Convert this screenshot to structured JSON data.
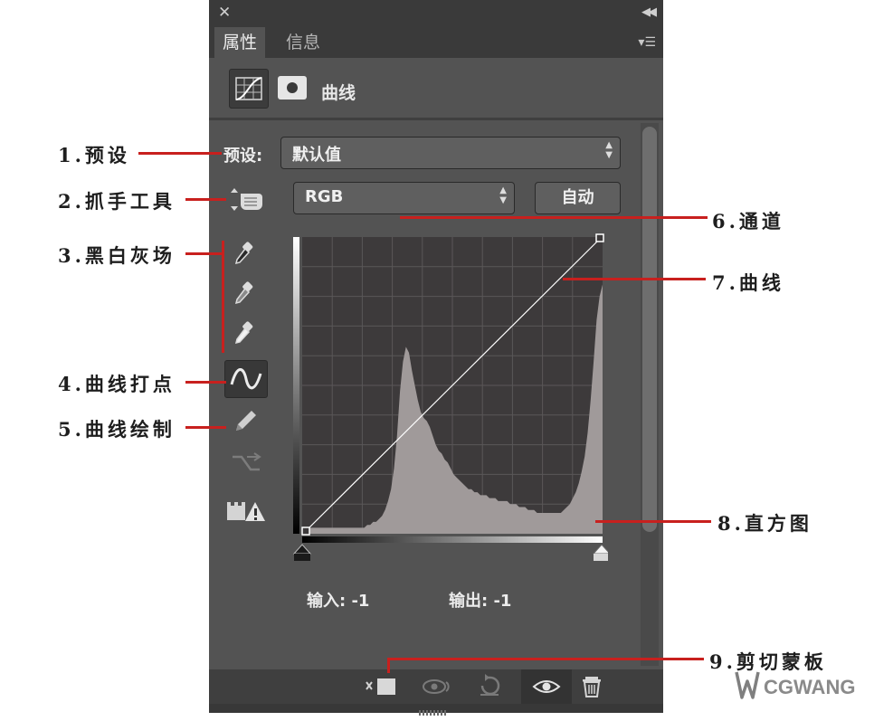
{
  "panel": {
    "tabs": [
      "属性",
      "信息"
    ],
    "active_tab": 0,
    "adjustment_title": "曲线",
    "preset_label": "预设:",
    "preset_value": "默认值",
    "channel_value": "RGB",
    "auto_button": "自动",
    "input_readout": "输入: -1",
    "output_readout": "输出: -1"
  },
  "annotations": [
    {
      "id": "1",
      "text": "1.预设"
    },
    {
      "id": "2",
      "text": "2.抓手工具"
    },
    {
      "id": "3",
      "text": "3.黑白灰场"
    },
    {
      "id": "4",
      "text": "4.曲线打点"
    },
    {
      "id": "5",
      "text": "5.曲线绘制"
    },
    {
      "id": "6",
      "text": "6.通道"
    },
    {
      "id": "7",
      "text": "7.曲线"
    },
    {
      "id": "8",
      "text": "8.直方图"
    },
    {
      "id": "9",
      "text": "9.剪切蒙板"
    }
  ],
  "icons": {
    "close": "close-icon",
    "collapse": "collapse-icon",
    "panel_menu": "panel-menu-icon",
    "curves_adjustment": "curves-adjustment-icon",
    "mask": "mask-icon",
    "hand_tool": "targeted-adjustment-hand-icon",
    "eyedroppers": [
      "black-point-eyedropper-icon",
      "gray-point-eyedropper-icon",
      "white-point-eyedropper-icon"
    ],
    "point_mode": "curve-point-edit-icon",
    "pencil_mode": "curve-pencil-icon",
    "smooth": "smooth-curve-icon",
    "clipping_warning": "clipping-warning-icon",
    "bottom": [
      "clip-to-layer-icon",
      "view-previous-state-icon",
      "reset-icon",
      "visibility-eye-icon",
      "delete-icon"
    ]
  },
  "watermark": "CGWANG",
  "colors": {
    "panel_bg": "#535353",
    "annotation_line": "#c8201e",
    "histogram_fill": "#a09a9a"
  },
  "histogram": [
    0.02,
    0.02,
    0.02,
    0.02,
    0.02,
    0.02,
    0.02,
    0.02,
    0.02,
    0.02,
    0.02,
    0.02,
    0.02,
    0.02,
    0.02,
    0.02,
    0.02,
    0.02,
    0.02,
    0.02,
    0.03,
    0.03,
    0.04,
    0.04,
    0.05,
    0.06,
    0.08,
    0.11,
    0.15,
    0.22,
    0.33,
    0.48,
    0.58,
    0.63,
    0.61,
    0.55,
    0.5,
    0.45,
    0.41,
    0.39,
    0.38,
    0.36,
    0.33,
    0.3,
    0.28,
    0.27,
    0.25,
    0.24,
    0.22,
    0.2,
    0.19,
    0.18,
    0.17,
    0.16,
    0.15,
    0.15,
    0.14,
    0.14,
    0.13,
    0.13,
    0.13,
    0.12,
    0.12,
    0.12,
    0.11,
    0.11,
    0.11,
    0.11,
    0.1,
    0.1,
    0.1,
    0.09,
    0.09,
    0.09,
    0.08,
    0.08,
    0.08,
    0.07,
    0.07,
    0.07,
    0.07,
    0.07,
    0.07,
    0.07,
    0.07,
    0.07,
    0.08,
    0.09,
    0.1,
    0.12,
    0.14,
    0.17,
    0.21,
    0.26,
    0.34,
    0.45,
    0.58,
    0.72,
    0.8,
    0.84
  ]
}
